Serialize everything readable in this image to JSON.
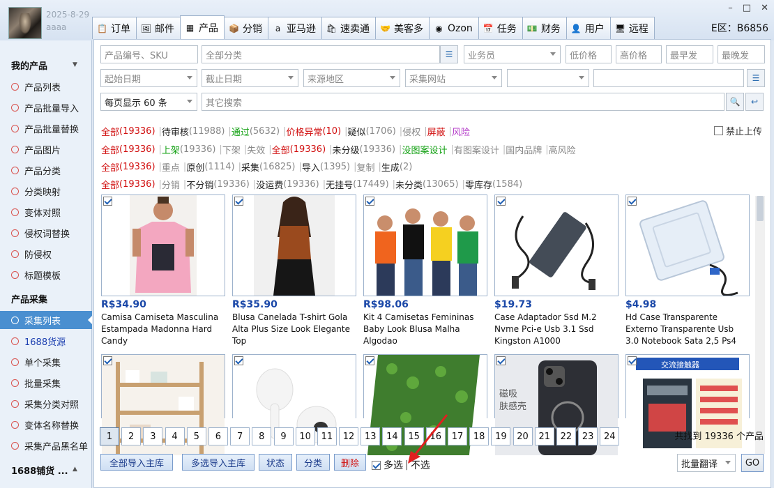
{
  "user": {
    "date": "2025-8-29",
    "name": "aaaa"
  },
  "window_controls": [
    "–",
    "□",
    "✕"
  ],
  "tabs": [
    {
      "label": "订单",
      "icon": "clipboard-icon",
      "glyph": "📋"
    },
    {
      "label": "邮件",
      "icon": "mail-icon",
      "glyph": "🖼"
    },
    {
      "label": "产品",
      "icon": "grid-icon",
      "glyph": "▦",
      "active": true
    },
    {
      "label": "分销",
      "icon": "package-icon",
      "glyph": "📦"
    },
    {
      "label": "亚马逊",
      "icon": "amazon-icon",
      "glyph": "a"
    },
    {
      "label": "速卖通",
      "icon": "aliexpress-icon",
      "glyph": "🛍"
    },
    {
      "label": "美客多",
      "icon": "mercadolibre-icon",
      "glyph": "🤝"
    },
    {
      "label": "Ozon",
      "icon": "ozon-icon",
      "glyph": "◉"
    },
    {
      "label": "任务",
      "icon": "task-icon",
      "glyph": "📅"
    },
    {
      "label": "财务",
      "icon": "finance-icon",
      "glyph": "💵"
    },
    {
      "label": "用户",
      "icon": "user-icon",
      "glyph": "👤"
    },
    {
      "label": "远程",
      "icon": "remote-icon",
      "glyph": "🖥"
    }
  ],
  "region": "E区：B6856",
  "sidebar": {
    "sections": [
      {
        "label": "我的产品"
      },
      {
        "label": "产品采集"
      },
      {
        "label": "1688铺货 ..."
      }
    ],
    "items_products": [
      "产品列表",
      "产品批量导入",
      "产品批量替换",
      "产品图片",
      "产品分类",
      "分类映射",
      "变体对照",
      "侵权词替换",
      "防侵权",
      "标题模板"
    ],
    "items_collect": [
      "采集列表",
      "1688货源",
      "单个采集",
      "批量采集",
      "采集分类对照",
      "变体名称替换",
      "采集产品黑名单"
    ]
  },
  "search": {
    "sku_placeholder": "产品编号、SKU",
    "category_placeholder": "全部分类",
    "staff_placeholder": "业务员",
    "low_price": "低价格",
    "high_price": "高价格",
    "earliest": "最早发",
    "latest": "最晚发",
    "start_date": "起始日期",
    "end_date": "截止日期",
    "region": "来源地区",
    "site": "采集网站",
    "page_size": "每页显示 60 条",
    "other_placeholder": "其它搜索"
  },
  "filters": {
    "row1": [
      {
        "t": "全部",
        "c": "red"
      },
      {
        "t": " (19336)",
        "c": "red"
      },
      {
        "t": "待审核",
        "c": ""
      },
      {
        "t": " (11988)",
        "c": "gray"
      },
      {
        "t": "通过",
        "c": "green"
      },
      {
        "t": " (5632)",
        "c": "gray"
      },
      {
        "t": "价格异常",
        "c": "red"
      },
      {
        "t": " (10)",
        "c": "red"
      },
      {
        "t": "疑似",
        "c": ""
      },
      {
        "t": " (1706)",
        "c": "gray"
      },
      {
        "t": "侵权",
        "c": "gray"
      },
      {
        "t": "屏蔽",
        "c": "red"
      },
      {
        "t": "风险",
        "c": "purple"
      }
    ],
    "row2": [
      {
        "t": "全部",
        "c": "red"
      },
      {
        "t": " (19336)",
        "c": "red"
      },
      {
        "t": "上架",
        "c": "green"
      },
      {
        "t": " (19336)",
        "c": "gray"
      },
      {
        "t": "下架",
        "c": "gray"
      },
      {
        "t": "失效",
        "c": "gray"
      },
      {
        "t": "全部",
        "c": "red"
      },
      {
        "t": " (19336)",
        "c": "red"
      },
      {
        "t": "未分级",
        "c": ""
      },
      {
        "t": " (19336)",
        "c": "gray"
      },
      {
        "t": "没图案设计",
        "c": "green"
      },
      {
        "t": "有图案设计",
        "c": "gray"
      },
      {
        "t": "国内品牌",
        "c": "gray"
      },
      {
        "t": "高风险",
        "c": "gray"
      }
    ],
    "row3": [
      {
        "t": "全部",
        "c": "red"
      },
      {
        "t": " (19336)",
        "c": "red"
      },
      {
        "t": "重点",
        "c": "gray"
      },
      {
        "t": "原创",
        "c": ""
      },
      {
        "t": " (1114)",
        "c": "gray"
      },
      {
        "t": "采集",
        "c": ""
      },
      {
        "t": " (16825)",
        "c": "gray"
      },
      {
        "t": "导入",
        "c": ""
      },
      {
        "t": " (1395)",
        "c": "gray"
      },
      {
        "t": "复制",
        "c": "gray"
      },
      {
        "t": "生成",
        "c": ""
      },
      {
        "t": " (2)",
        "c": "gray"
      }
    ],
    "row4": [
      {
        "t": "全部",
        "c": "red"
      },
      {
        "t": " (19336)",
        "c": "red"
      },
      {
        "t": "分销",
        "c": "gray"
      },
      {
        "t": "不分销",
        "c": ""
      },
      {
        "t": " (19336)",
        "c": "gray"
      },
      {
        "t": "没运费",
        "c": ""
      },
      {
        "t": " (19336)",
        "c": "gray"
      },
      {
        "t": "无挂号",
        "c": ""
      },
      {
        "t": " (17449)",
        "c": "gray"
      },
      {
        "t": "未分类",
        "c": ""
      },
      {
        "t": " (13065)",
        "c": "gray"
      },
      {
        "t": "零库存",
        "c": ""
      },
      {
        "t": " (1584)",
        "c": "gray"
      }
    ],
    "block_upload": "禁止上传"
  },
  "products": [
    {
      "price": "R$34.90",
      "title": "Camisa Camiseta Masculina Estampada Madonna Hard Candy",
      "image": "tshirt-man-photo"
    },
    {
      "price": "R$35.90",
      "title": "Blusa Canelada T-shirt Gola Alta Plus Size Look Elegante Top",
      "image": "woman-top-photo"
    },
    {
      "price": "R$98.06",
      "title": "Kit 4 Camisetas Femininas Baby Look Blusa Malha Algodao",
      "image": "four-women-photo"
    },
    {
      "price": "$19.73",
      "title": "Case Adaptador Ssd M.2 Nvme Pci-e Usb 3.1 Ssd Kingston A1000",
      "image": "ssd-case-photo"
    },
    {
      "price": "$4.98",
      "title": "Hd Case Transparente Externo Transparente Usb 3.0 Notebook Sata 2,5 Ps4",
      "image": "hdd-case-photo"
    },
    {
      "price": "",
      "title": "",
      "image": "shelf-photo"
    },
    {
      "price": "",
      "title": "",
      "image": "earbuds-photo"
    },
    {
      "price": "",
      "title": "",
      "image": "hedge-photo"
    },
    {
      "price": "",
      "title": "磁吸肤感壳",
      "image": "phone-case-photo"
    },
    {
      "price": "",
      "title": "交流接触器",
      "image": "contactor-photo"
    }
  ],
  "pager": {
    "pages": [
      "1",
      "2",
      "3",
      "4",
      "5",
      "6",
      "7",
      "8",
      "9",
      "10",
      "11",
      "12",
      "13",
      "14",
      "15",
      "16",
      "17",
      "18",
      "19",
      "20",
      "21",
      "22",
      "23",
      "24"
    ],
    "current": "1",
    "found": "共找到 19336 个产品"
  },
  "actions": {
    "import_all": "全部导入主库",
    "import_selected": "多选导入主库",
    "status": "状态",
    "category": "分类",
    "delete": "删除",
    "multi": "多选",
    "none": "不选",
    "translate": "批量翻译",
    "go": "GO"
  }
}
